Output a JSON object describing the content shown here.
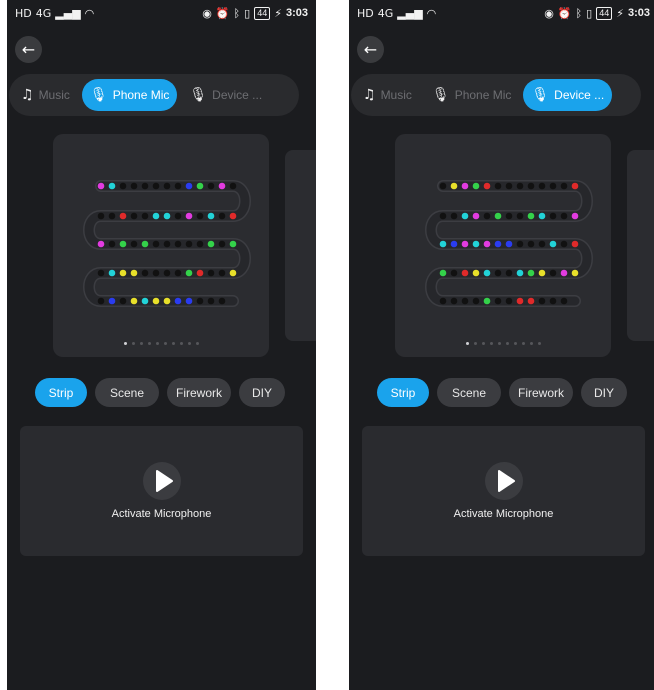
{
  "screens": [
    {
      "id": "left",
      "status": {
        "left_icons": [
          "HD",
          "4G",
          "signal-icon",
          "wifi-icon"
        ],
        "right_icons": [
          "eye-icon",
          "alarm-icon",
          "bluetooth-icon",
          "vibrate-icon"
        ],
        "battery": "44",
        "time": "3:03"
      },
      "modes": [
        {
          "label": "Music",
          "icon": "music-note-icon",
          "active": false
        },
        {
          "label": "Phone Mic",
          "icon": "mic-icon",
          "active": true
        },
        {
          "label": "Device ...",
          "icon": "mic-icon",
          "active": false
        }
      ],
      "pager": {
        "pages": 10,
        "current": 1
      },
      "strip_colors": [
        "#e23be0",
        "#22d3d8",
        "#111111",
        "#111111",
        "#111111",
        "#111111",
        "#111111",
        "#111111",
        "#2a3cf0",
        "#34d24a",
        "#111111",
        "#e23be0",
        "#111111",
        "#e02a2a",
        "#111111",
        "#22d3d8",
        "#111111",
        "#e23be0",
        "#111111",
        "#22d3d8",
        "#22d3d8",
        "#111111",
        "#111111",
        "#e02a2a",
        "#111111",
        "#111111",
        "#e23be0",
        "#111111",
        "#34d24a",
        "#111111",
        "#34d24a",
        "#111111",
        "#111111",
        "#111111",
        "#111111",
        "#111111",
        "#34d24a",
        "#111111",
        "#34d24a",
        "#e8e02a",
        "#111111",
        "#111111",
        "#e02a2a",
        "#34d24a",
        "#111111",
        "#111111",
        "#111111",
        "#111111",
        "#e8e02a",
        "#e8e02a",
        "#22d3d8",
        "#111111",
        "#111111",
        "#2a3cf0",
        "#111111",
        "#e8e02a",
        "#22d3d8",
        "#e8e02a",
        "#e8e02a",
        "#2a3cf0",
        "#2a3cf0",
        "#111111",
        "#111111",
        "#111111"
      ],
      "effects": [
        {
          "label": "Strip",
          "active": true
        },
        {
          "label": "Scene",
          "active": false
        },
        {
          "label": "Firework",
          "active": false
        },
        {
          "label": "DIY",
          "active": false
        }
      ],
      "activate_label": "Activate Microphone"
    },
    {
      "id": "right",
      "status": {
        "left_icons": [
          "HD",
          "4G",
          "signal-icon",
          "wifi-icon"
        ],
        "right_icons": [
          "eye-icon",
          "alarm-icon",
          "bluetooth-icon",
          "vibrate-icon"
        ],
        "battery": "44",
        "time": "3:03"
      },
      "modes": [
        {
          "label": "Music",
          "icon": "music-note-icon",
          "active": false
        },
        {
          "label": "Phone Mic",
          "icon": "mic-icon",
          "active": false
        },
        {
          "label": "Device ...",
          "icon": "mic-icon",
          "active": true
        }
      ],
      "pager": {
        "pages": 10,
        "current": 1
      },
      "strip_colors": [
        "#111111",
        "#e8e02a",
        "#e23be0",
        "#34d24a",
        "#e02a2a",
        "#111111",
        "#111111",
        "#111111",
        "#111111",
        "#111111",
        "#111111",
        "#111111",
        "#e02a2a",
        "#e23be0",
        "#111111",
        "#111111",
        "#22d3d8",
        "#34d24a",
        "#111111",
        "#111111",
        "#34d24a",
        "#111111",
        "#e23be0",
        "#22d3d8",
        "#111111",
        "#111111",
        "#22d3d8",
        "#2a3cf0",
        "#e23be0",
        "#22d3d8",
        "#e23be0",
        "#2a3cf0",
        "#2a3cf0",
        "#111111",
        "#111111",
        "#111111",
        "#22d3d8",
        "#111111",
        "#e02a2a",
        "#e8e02a",
        "#e23be0",
        "#111111",
        "#e8e02a",
        "#34d24a",
        "#22d3d8",
        "#111111",
        "#111111",
        "#22d3d8",
        "#e8e02a",
        "#e02a2a",
        "#111111",
        "#34d24a",
        "#111111",
        "#111111",
        "#111111",
        "#111111",
        "#34d24a",
        "#111111",
        "#111111",
        "#e02a2a",
        "#e02a2a",
        "#111111",
        "#111111",
        "#111111"
      ],
      "effects": [
        {
          "label": "Strip",
          "active": true
        },
        {
          "label": "Scene",
          "active": false
        },
        {
          "label": "Firework",
          "active": false
        },
        {
          "label": "DIY",
          "active": false
        }
      ],
      "activate_label": "Activate Microphone"
    }
  ]
}
